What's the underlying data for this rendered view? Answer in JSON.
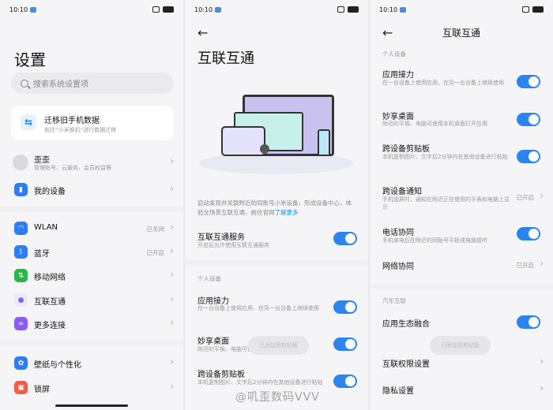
{
  "status": {
    "time": "10:10"
  },
  "settings": {
    "title": "设置",
    "search_placeholder": "搜索系统设置项",
    "migrate": {
      "title": "迁移旧手机数据",
      "desc": "前往“小米换机”进行数据迁移"
    },
    "account": {
      "name": "歪歪",
      "desc": "管理账号、云服务、会员权益等"
    },
    "my_device": "我的设备",
    "items": [
      {
        "label": "WLAN",
        "value": "已关闭",
        "icon": "wifi-icon",
        "color": "#2f7cf6"
      },
      {
        "label": "蓝牙",
        "value": "已开启",
        "icon": "bluetooth-icon",
        "color": "#2f7cf6"
      },
      {
        "label": "移动网络",
        "value": "",
        "icon": "mobile-network-icon",
        "color": "#2db34a"
      },
      {
        "label": "互联互通",
        "value": "",
        "icon": "interconnect-icon",
        "color": "#7a6cf0"
      },
      {
        "label": "更多连接",
        "value": "",
        "icon": "more-connect-icon",
        "color": "#8a5cf5"
      }
    ],
    "items2": [
      {
        "label": "壁纸与个性化",
        "icon": "wallpaper-icon",
        "color": "#2f7cf6"
      },
      {
        "label": "锁屏",
        "icon": "lock-icon",
        "color": "#f25a4a"
      }
    ]
  },
  "interconnect": {
    "title": "互联互通",
    "intro": "启动发现并关联附近的同账号小米设备，形成设备中心，体验全场景互联互通，前往官网",
    "learn_more": "了解更多",
    "service": {
      "title": "互联互通服务",
      "desc": "开启后允许使用互联互通服务"
    },
    "section_personal": "个人设备",
    "app_relay": {
      "title": "应用接力",
      "desc": "在一台设备上使用应用，在另一台设备上继续使用"
    },
    "share_desktop": {
      "title": "妙享桌面",
      "desc": "附近的平板、电脑可使用本机桌面打开应用"
    },
    "clipboard": {
      "title": "跨设备剪贴板",
      "desc": "本机复制图片、文字后2分钟内在其他设备进行粘贴"
    },
    "toast": "已添加到剪贴板"
  },
  "detail": {
    "title": "互联互通",
    "section_personal": "个人设备",
    "app_relay": {
      "title": "应用接力",
      "desc": "在一台设备上使用应用，在另一台设备上继续使用"
    },
    "share_desktop": {
      "title": "妙享桌面",
      "desc": "附近的平板、电脑可使用本机桌面打开应用"
    },
    "clipboard": {
      "title": "跨设备剪贴板",
      "desc": "本机复制图片、文字后2分钟内在其他设备进行粘贴"
    },
    "notify": {
      "title": "跨设备通知",
      "desc": "手机锁屏时，通知在附近正在使用的手表和电脑上显示",
      "value": "已开启"
    },
    "call": {
      "title": "电话协同",
      "desc": "手机来电后在附近的同账号平板或电脑接听"
    },
    "network": {
      "title": "网络协同",
      "value": "已开启"
    },
    "section_car": "汽车互联",
    "app_eco": {
      "title": "应用生态融合"
    },
    "permissions": "互联权限设置",
    "privacy": "隐私设置",
    "toast": "已添加到剪贴板"
  },
  "watermark": "@叽歪数码VVV"
}
